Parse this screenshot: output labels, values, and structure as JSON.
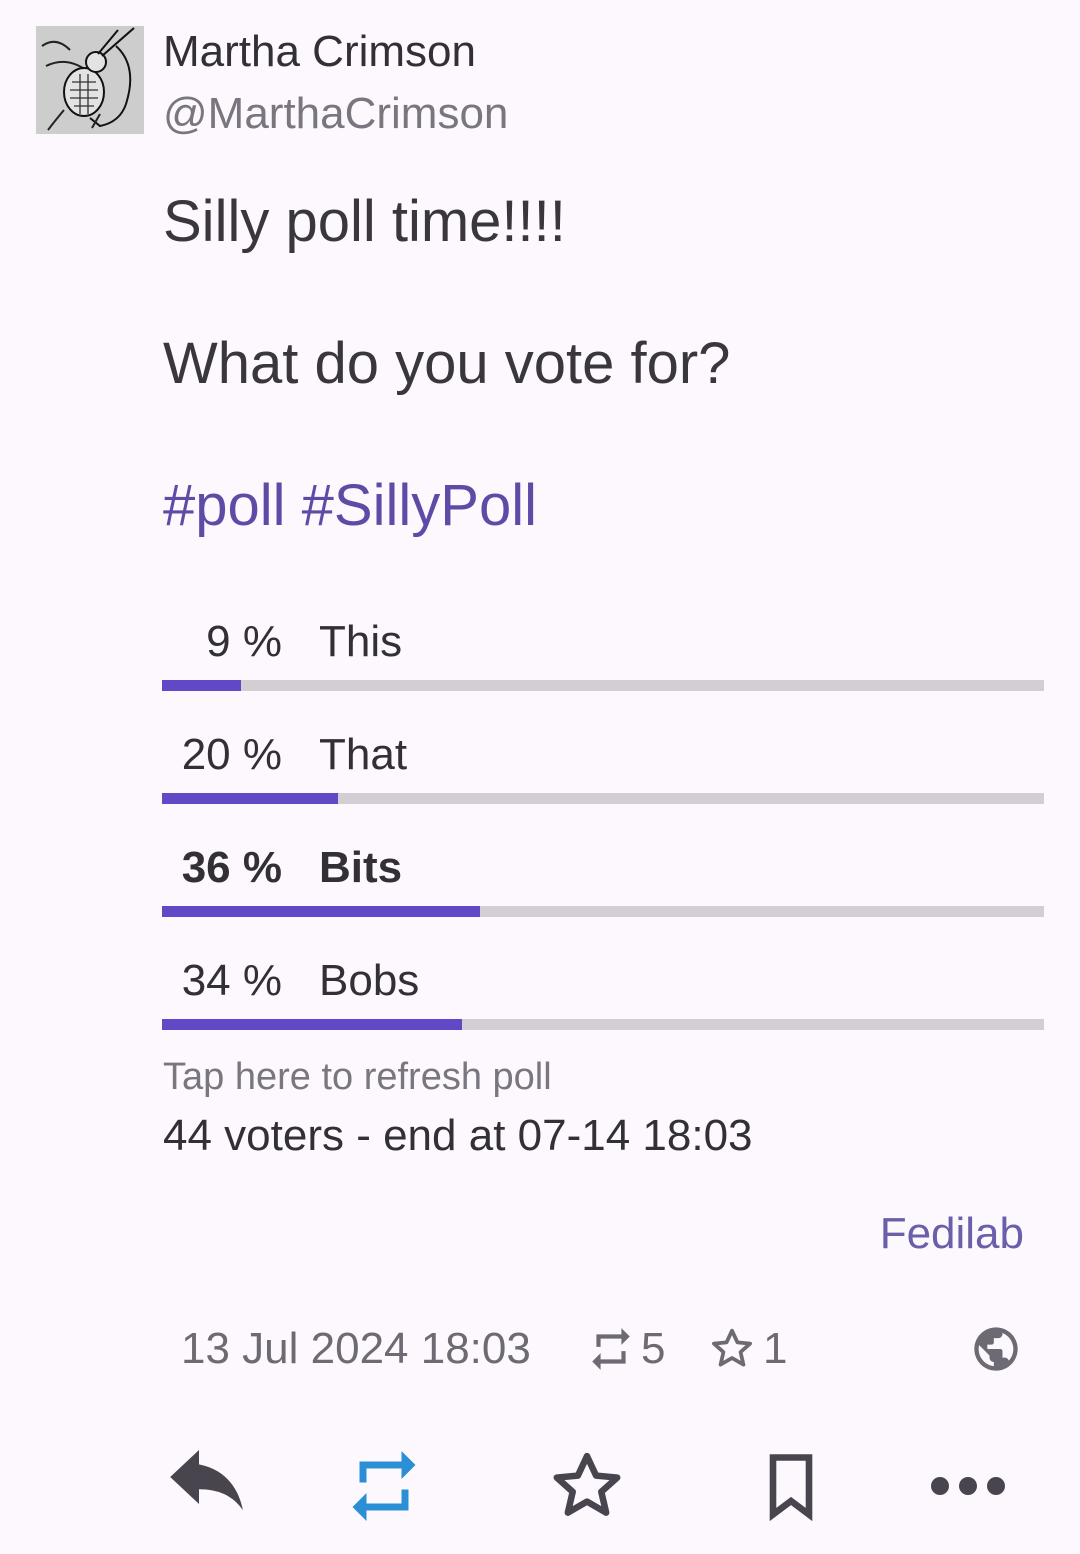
{
  "author": {
    "display_name": "Martha Crimson",
    "handle": "@MarthaCrimson"
  },
  "post": {
    "line1": "Silly poll time!!!!",
    "line2": "What do you vote for?",
    "hashtags": [
      "#poll",
      "#SillyPoll"
    ]
  },
  "poll": {
    "options": [
      {
        "percent_label": "9 %",
        "label": "This",
        "percent": 9
      },
      {
        "percent_label": "20 %",
        "label": "That",
        "percent": 20
      },
      {
        "percent_label": "36 %",
        "label": "Bits",
        "percent": 36
      },
      {
        "percent_label": "34 %",
        "label": "Bobs",
        "percent": 34
      }
    ],
    "refresh_label": "Tap here to refresh poll",
    "meta": "44 voters - end at 07-14 18:03"
  },
  "app_name": "Fedilab",
  "footer": {
    "date": "13 Jul 2024 18:03",
    "boost_count": "5",
    "favourite_count": "1",
    "visibility_icon": "globe-icon"
  },
  "actions": [
    {
      "icon": "reply-icon"
    },
    {
      "icon": "boost-icon"
    },
    {
      "icon": "favourite-icon"
    },
    {
      "icon": "bookmark-icon"
    },
    {
      "icon": "more-icon"
    }
  ],
  "colors": {
    "accent": "#6248c6",
    "hashtag": "#5f4ba6",
    "boost_active": "#2b8fd6",
    "track": "#d2ced3"
  }
}
